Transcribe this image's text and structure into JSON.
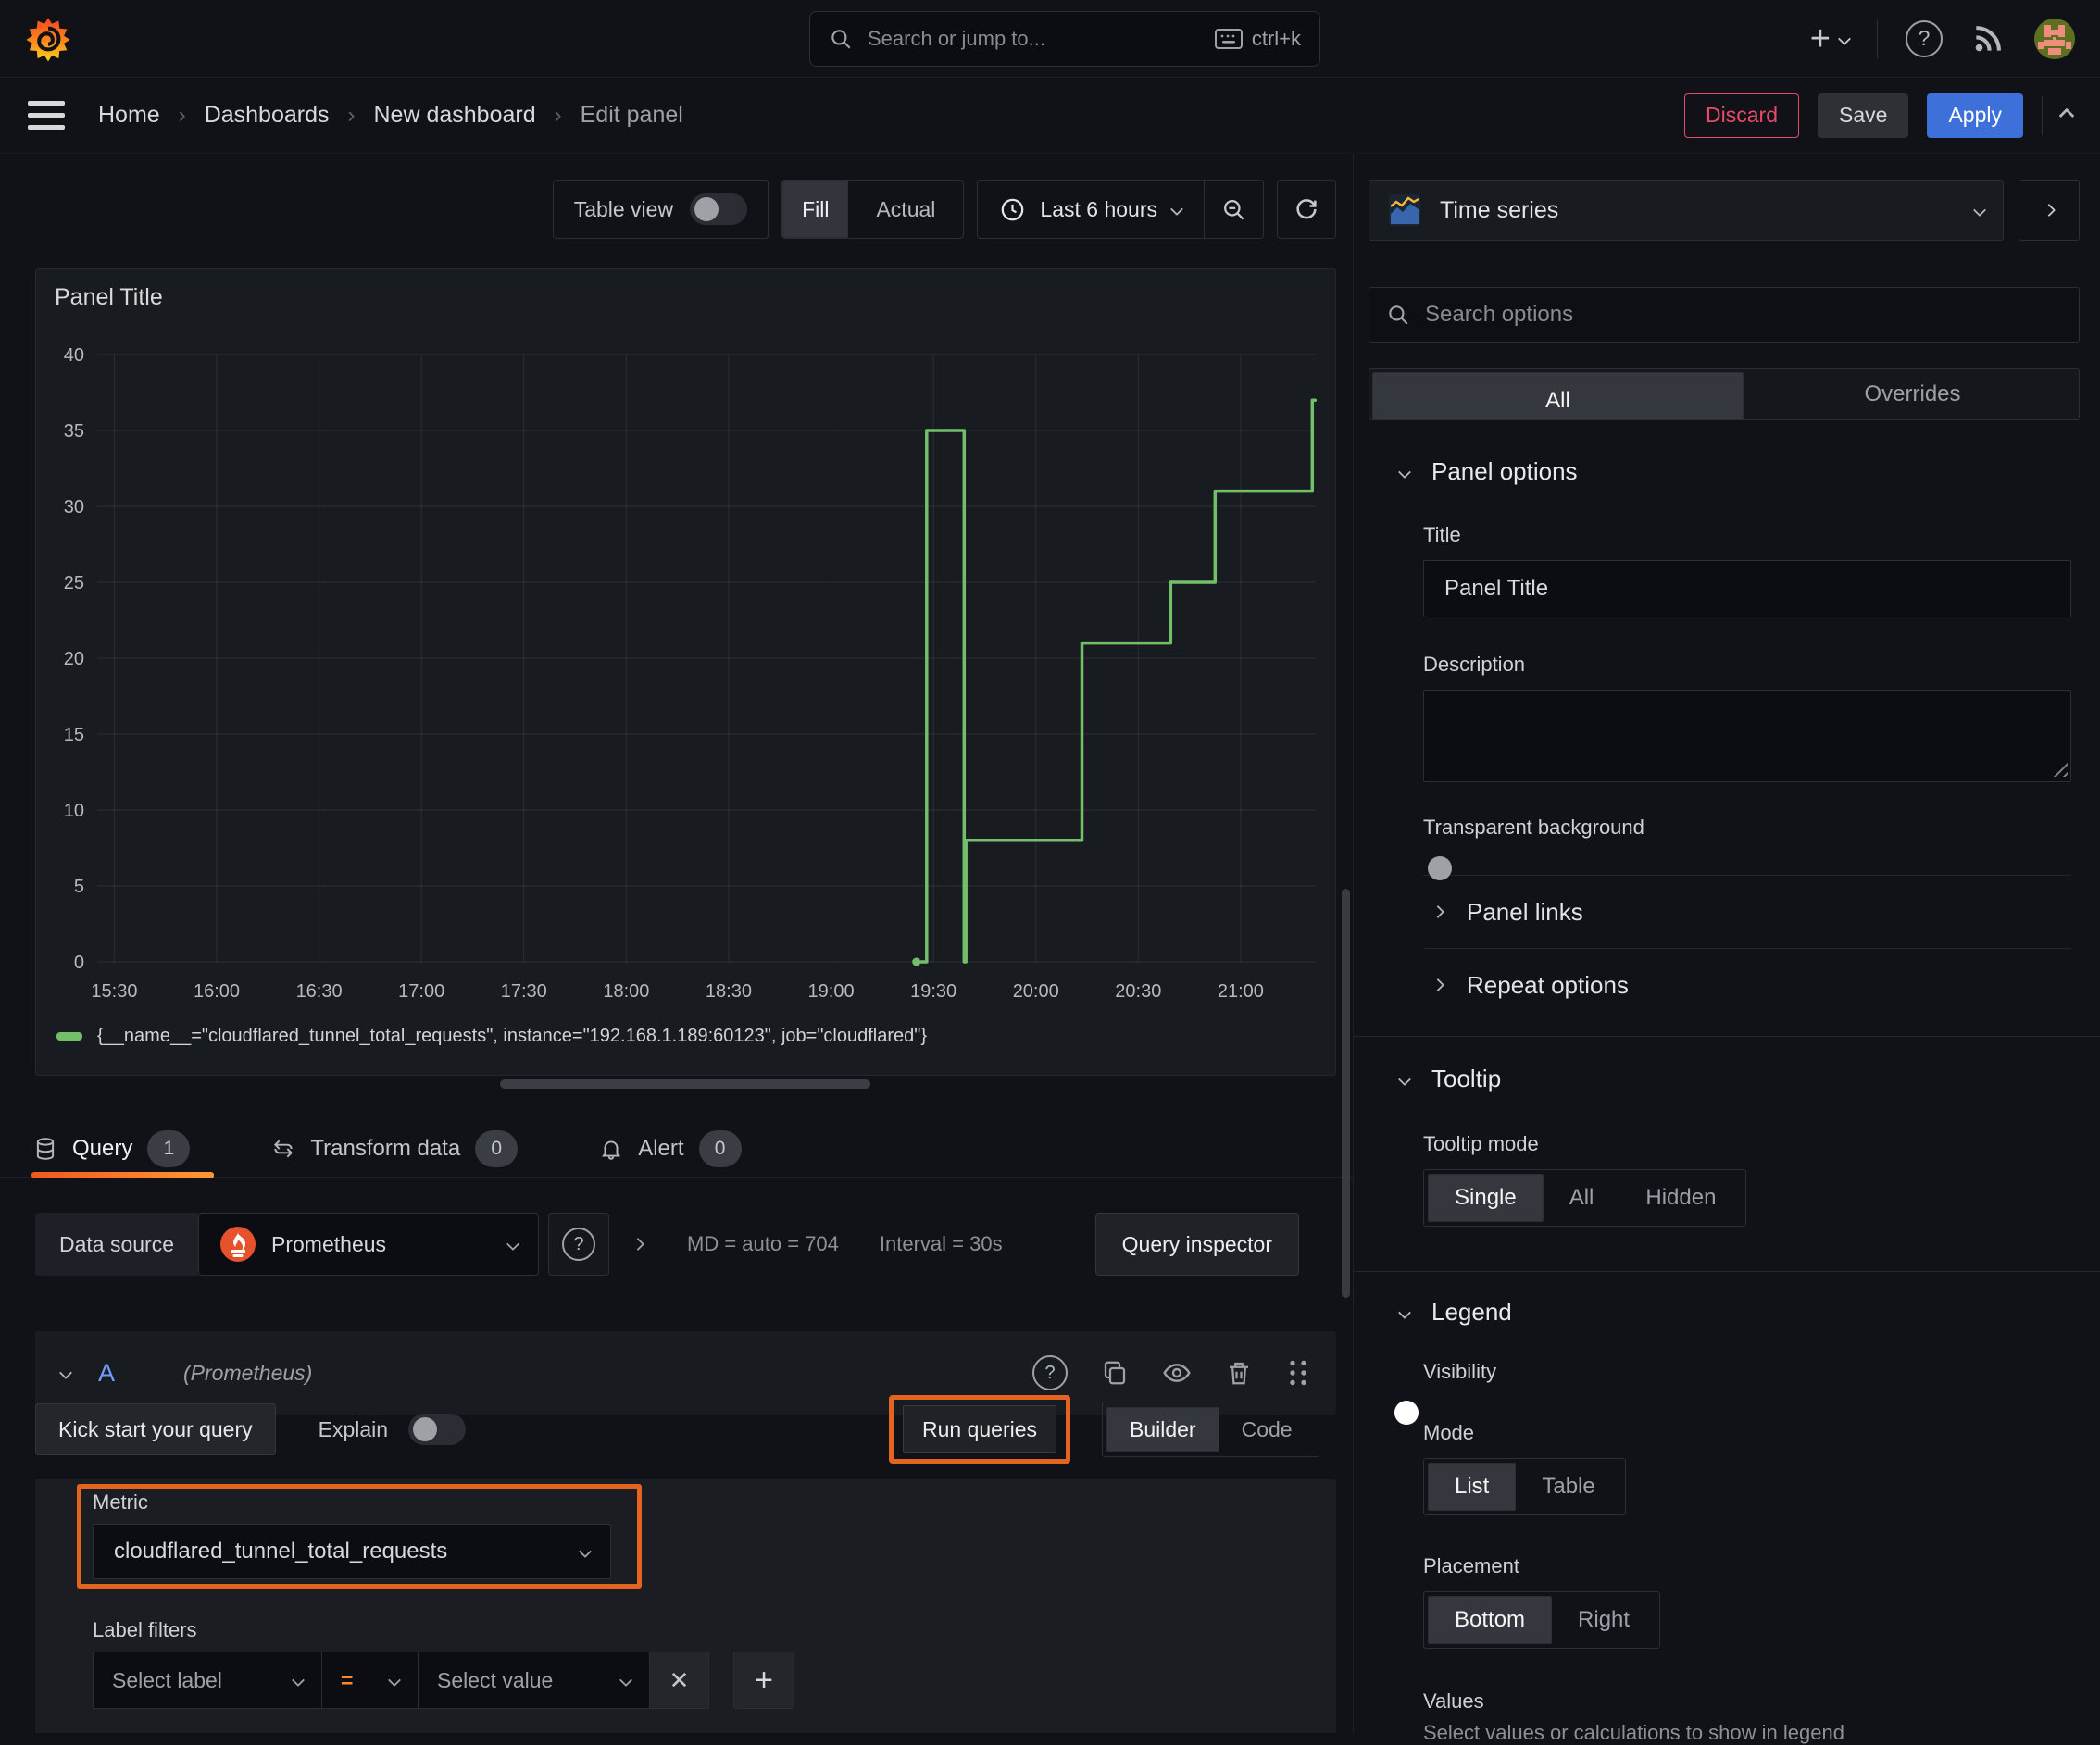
{
  "topbar": {
    "search_placeholder": "Search or jump to...",
    "shortcut": "ctrl+k"
  },
  "breadcrumb": {
    "separator": "›",
    "items": [
      "Home",
      "Dashboards",
      "New dashboard",
      "Edit panel"
    ]
  },
  "actions": {
    "discard": "Discard",
    "save": "Save",
    "apply": "Apply"
  },
  "panel_toolbar": {
    "table_view": "Table view",
    "fill": "Fill",
    "actual": "Actual",
    "time_range": "Last 6 hours"
  },
  "panel": {
    "title": "Panel Title"
  },
  "chart_data": {
    "type": "line",
    "title": "Panel Title",
    "x_axis": {
      "tick_labels": [
        "15:30",
        "16:00",
        "16:30",
        "17:00",
        "17:30",
        "18:00",
        "18:30",
        "19:00",
        "19:30",
        "20:00",
        "20:30",
        "21:00"
      ],
      "tick_minutes": [
        30,
        60,
        90,
        120,
        150,
        180,
        210,
        240,
        270,
        300,
        330,
        360
      ],
      "range_minutes": [
        25,
        382
      ],
      "minutes_origin": "15:00"
    },
    "y_axis": {
      "ticks": [
        0,
        5,
        10,
        15,
        20,
        25,
        30,
        35,
        40
      ],
      "range": [
        0,
        40
      ]
    },
    "grid": true,
    "legend_position": "bottom",
    "series": [
      {
        "name": "{__name__=\"cloudflared_tunnel_total_requests\", instance=\"192.168.1.189:60123\", job=\"cloudflared\"}",
        "color": "#73bf69",
        "points": [
          [
            265,
            0
          ],
          [
            268,
            0
          ],
          [
            268,
            35
          ],
          [
            279,
            35
          ],
          [
            279,
            0
          ],
          [
            279.5,
            0
          ],
          [
            279.5,
            8
          ],
          [
            313.5,
            8
          ],
          [
            313.5,
            21
          ],
          [
            339.5,
            21
          ],
          [
            339.5,
            25
          ],
          [
            352.5,
            25
          ],
          [
            352.5,
            31
          ],
          [
            381,
            31
          ],
          [
            381,
            37
          ],
          [
            381.8,
            37
          ]
        ]
      }
    ]
  },
  "query_tabs": [
    {
      "label": "Query",
      "badge": "1"
    },
    {
      "label": "Transform data",
      "badge": "0"
    },
    {
      "label": "Alert",
      "badge": "0"
    }
  ],
  "datasource": {
    "label": "Data source",
    "name": "Prometheus",
    "stats_md": "MD = auto = 704",
    "stats_interval": "Interval = 30s",
    "inspector": "Query inspector"
  },
  "query": {
    "ref": "A",
    "ds_hint": "(Prometheus)",
    "kick_start": "Kick start your query",
    "explain": "Explain",
    "run": "Run queries",
    "builder": "Builder",
    "code": "Code",
    "metric_label": "Metric",
    "metric_value": "cloudflared_tunnel_total_requests",
    "label_filters": "Label filters",
    "select_label": "Select label",
    "operator": "=",
    "select_value": "Select value",
    "remove": "✕",
    "add": "+"
  },
  "options": {
    "viz": "Time series",
    "search_placeholder": "Search options",
    "tab_all": "All",
    "tab_overrides": "Overrides",
    "panel_options": {
      "header": "Panel options",
      "title_label": "Title",
      "title_value": "Panel Title",
      "description_label": "Description",
      "transparent": "Transparent background"
    },
    "links": "Panel links",
    "repeat": "Repeat options",
    "tooltip": {
      "header": "Tooltip",
      "mode_label": "Tooltip mode",
      "modes": [
        "Single",
        "All",
        "Hidden"
      ],
      "selected": "Single"
    },
    "legend": {
      "header": "Legend",
      "visibility": "Visibility",
      "mode_label": "Mode",
      "modes": [
        "List",
        "Table"
      ],
      "selected_mode": "List",
      "placement_label": "Placement",
      "placements": [
        "Bottom",
        "Right"
      ],
      "selected_placement": "Bottom",
      "values_label": "Values",
      "values_hint": "Select values or calculations to show in legend"
    }
  },
  "colors": {
    "accent_orange": "#e2641e",
    "series_green": "#73bf69",
    "primary_blue": "#3d71d9",
    "discard_red": "#e84a6b"
  }
}
